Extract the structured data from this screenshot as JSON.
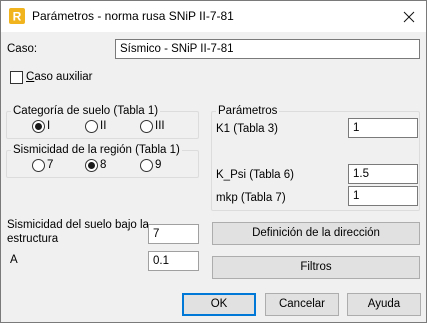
{
  "window": {
    "title": "Parámetros - norma rusa SNiP II-7-81",
    "icon": "app-r-icon",
    "accent": "#f2b41e"
  },
  "caso": {
    "label": "Caso:",
    "value": "Sísmico - SNiP II-7-81"
  },
  "caso_auxiliar": {
    "label_first": "C",
    "label_rest": "aso auxiliar",
    "checked": false
  },
  "soil_category": {
    "title": "Categoría de suelo (Tabla 1)",
    "options": [
      {
        "label": "I",
        "checked": true
      },
      {
        "label": "II",
        "checked": false
      },
      {
        "label": "III",
        "checked": false
      }
    ]
  },
  "region_seismicity": {
    "title": "Sismicidad de la región (Tabla 1)",
    "options": [
      {
        "label": "7",
        "checked": false
      },
      {
        "label": "8",
        "checked": true
      },
      {
        "label": "9",
        "checked": false
      }
    ]
  },
  "params": {
    "title": "Parámetros",
    "k1_label": "K1 (Tabla 3)",
    "k1_value": "1",
    "kpsi_label": "K_Psi (Tabla 6)",
    "kpsi_value": "1.5",
    "mkp_label": "mkp (Tabla 7)",
    "mkp_value": "1"
  },
  "structure_seismicity": {
    "label_line1": "Sismicidad del suelo bajo la",
    "label_line2": "estructura",
    "value": "7"
  },
  "a": {
    "label": "A",
    "value": "0.1"
  },
  "buttons": {
    "direction": "Definición de la dirección",
    "filters": "Filtros",
    "ok": "OK",
    "cancel": "Cancelar",
    "help": "Ayuda"
  }
}
